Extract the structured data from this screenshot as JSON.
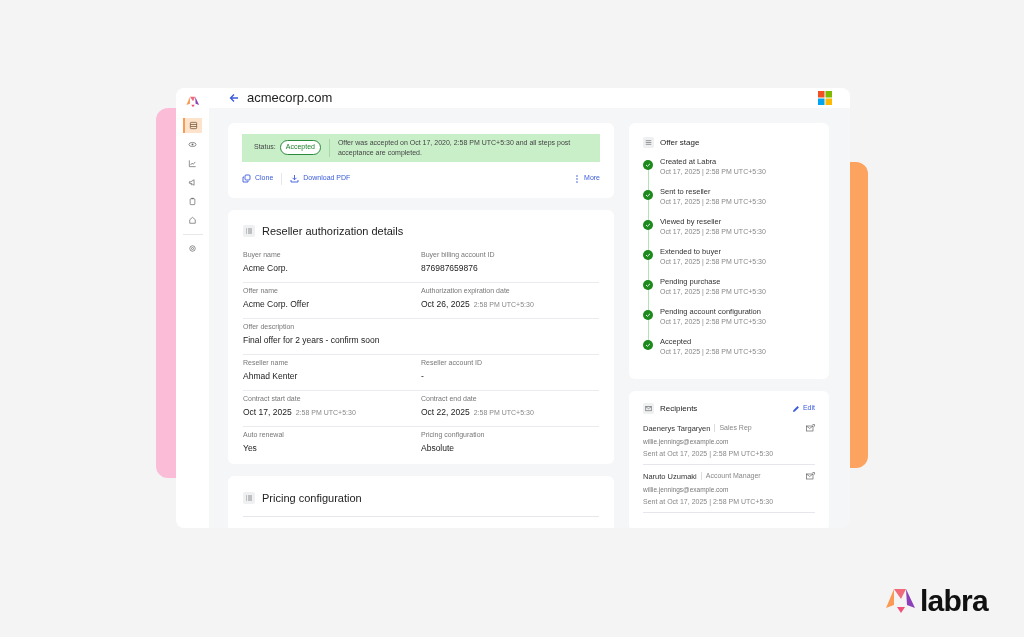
{
  "header": {
    "title": "acmecorp.com"
  },
  "sidebar": {
    "items": [
      {
        "selected": true
      },
      {
        "selected": false
      },
      {
        "selected": false
      },
      {
        "selected": false
      },
      {
        "selected": false
      },
      {
        "selected": false
      },
      {
        "selected": false
      }
    ]
  },
  "status": {
    "label": "Status:",
    "badge": "Accepted",
    "message": "Offer was accepted on Oct 17, 2020, 2:58 PM UTC+5:30 and all steps post acceptance are completed."
  },
  "actions": [
    {
      "kind": "clone",
      "label": "Clone"
    },
    {
      "kind": "download",
      "label": "Download PDF"
    }
  ],
  "more": {
    "label": "More"
  },
  "reseller_details": {
    "title": "Reseller authorization details",
    "rows": [
      [
        {
          "label": "Buyer name",
          "value": "Acme Corp."
        },
        {
          "label": "Buyer billing account ID",
          "value": "876987659876"
        }
      ],
      [
        {
          "label": "Offer name",
          "value": "Acme Corp. Offer"
        },
        {
          "label": "Authorization expiration date",
          "value": "Oct 26, 2025",
          "time": "2:58 PM UTC+5:30"
        }
      ],
      [
        {
          "label": "Offer description",
          "value": "Final offer for 2 years - confirm soon"
        }
      ],
      [
        {
          "label": "Reseller name",
          "value": "Ahmad Kenter"
        },
        {
          "label": "Reseller account ID",
          "value": "-"
        }
      ],
      [
        {
          "label": "Contract start date",
          "value": "Oct 17, 2025",
          "time": "2:58 PM UTC+5:30"
        },
        {
          "label": "Contract end date",
          "value": "Oct 22, 2025",
          "time": "2:58 PM UTC+5:30"
        }
      ],
      [
        {
          "label": "Auto renewal",
          "value": "Yes"
        },
        {
          "label": "Pricing configuration",
          "value": "Absolute"
        }
      ]
    ]
  },
  "pricing": {
    "title": "Pricing configuration"
  },
  "offer_stage": {
    "title": "Offer stage",
    "steps": [
      {
        "name": "Created at Labra",
        "time": "Oct 17, 2025 | 2:58 PM UTC+5:30",
        "done": true
      },
      {
        "name": "Sent to reseller",
        "time": "Oct 17, 2025 | 2:58 PM UTC+5:30",
        "done": true
      },
      {
        "name": "Viewed by reseller",
        "time": "Oct 17, 2025 | 2:58 PM UTC+5:30",
        "done": true
      },
      {
        "name": "Extended to buyer",
        "time": "Oct 17, 2025 | 2:58 PM UTC+5:30",
        "done": true
      },
      {
        "name": "Pending purchase",
        "time": "Oct 17, 2025 | 2:58 PM UTC+5:30",
        "done": true
      },
      {
        "name": "Pending account configuration",
        "time": "Oct 17, 2025 | 2:58 PM UTC+5:30",
        "done": true
      },
      {
        "name": "Accepted",
        "time": "Oct 17, 2025 | 2:58 PM UTC+5:30",
        "done": true
      }
    ]
  },
  "recipients": {
    "title": "Recipients",
    "edit": "Edit",
    "items": [
      {
        "name": "Daenerys Targaryen",
        "role": "Sales Rep",
        "email": "willie.jennings@example.com",
        "sent": "Sent at Oct 17, 2025 | 2:58 PM UTC+5:30"
      },
      {
        "name": "Naruto Uzumaki",
        "role": "Account Manager",
        "email": "willie.jennings@example.com",
        "sent": "Sent at Oct 17, 2025 | 2:58 PM UTC+5:30"
      }
    ]
  },
  "brand": {
    "name": "labra"
  }
}
